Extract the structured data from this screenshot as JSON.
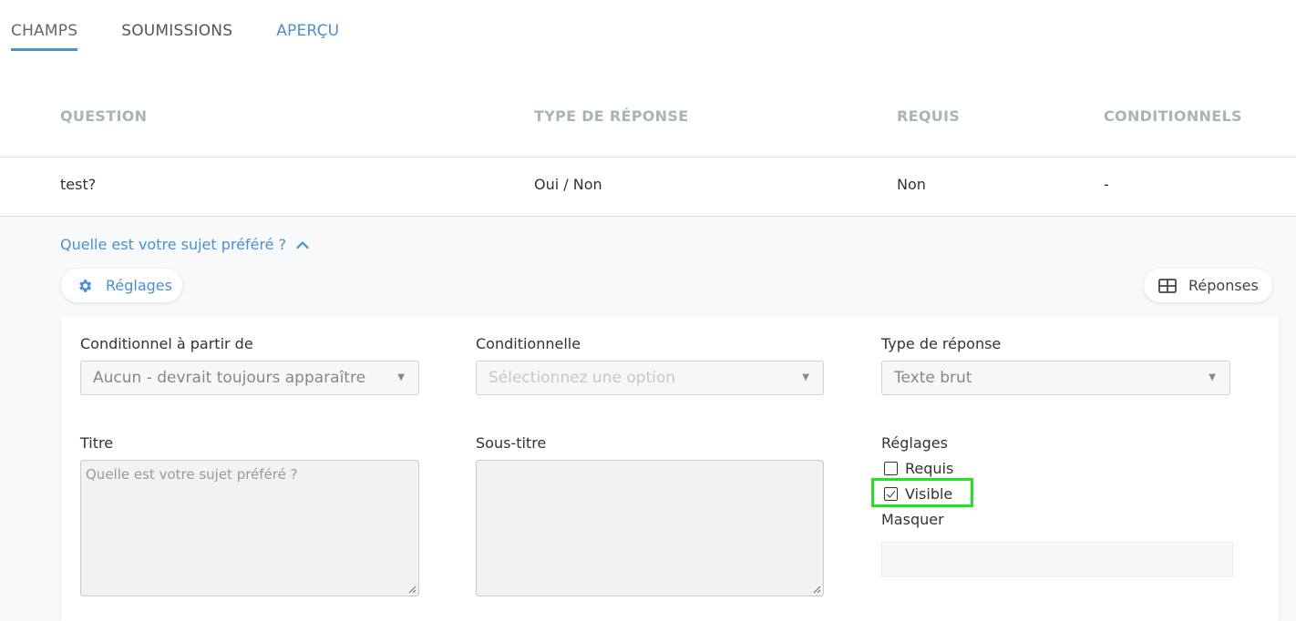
{
  "tabs": [
    {
      "label": "CHAMPS"
    },
    {
      "label": "SOUMISSIONS"
    },
    {
      "label": "APERÇU"
    }
  ],
  "table": {
    "headers": [
      "QUESTION",
      "TYPE DE RÉPONSE",
      "REQUIS",
      "CONDITIONNELS"
    ],
    "rows": [
      [
        "test?",
        "Oui / Non",
        "Non",
        "-"
      ]
    ]
  },
  "expanded": {
    "question_link": "Quelle est votre sujet préféré ?",
    "settings_button": "Réglages",
    "responses_button": "Réponses",
    "fields": {
      "conditional_from_label": "Conditionnel à partir de",
      "conditional_from_value": "Aucun - devrait toujours apparaître",
      "conditional_label": "Conditionnelle",
      "conditional_placeholder": "Sélectionnez une option",
      "response_type_label": "Type de réponse",
      "response_type_value": "Texte brut",
      "title_label": "Titre",
      "title_placeholder": "Quelle est votre sujet préféré ?",
      "subtitle_label": "Sous-titre",
      "subtitle_value": "",
      "settings_label": "Réglages",
      "required_label": "Requis",
      "required_checked": false,
      "visible_label": "Visible",
      "visible_checked": true,
      "hide_label": "Masquer",
      "hide_value": ""
    }
  },
  "colors": {
    "accent": "#4a90d9",
    "highlight": "#1ee61e",
    "header_text": "#a9b3bb"
  }
}
